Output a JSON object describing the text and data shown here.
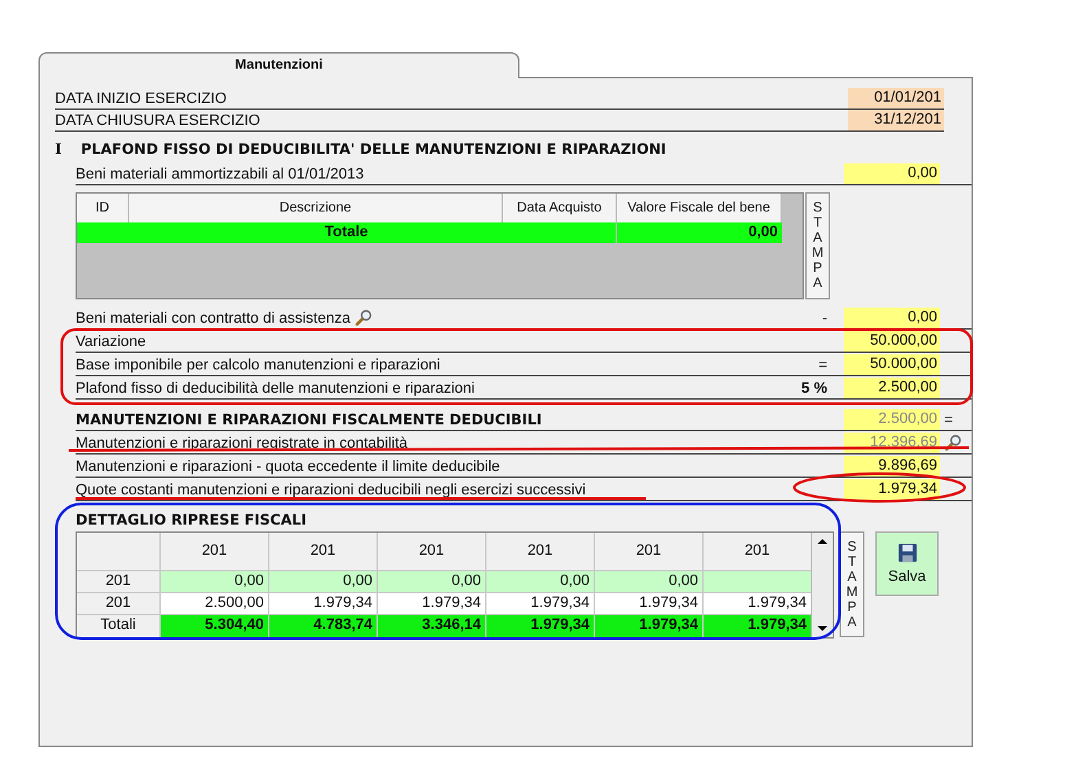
{
  "tabs": [
    {
      "label": "Manutenzioni",
      "selected": true
    }
  ],
  "dates": [
    {
      "label": "DATA INIZIO ESERCIZIO",
      "value": "01/01/201"
    },
    {
      "label": "DATA CHIUSURA ESERCIZIO",
      "value": "31/12/201"
    }
  ],
  "section": {
    "number": "I",
    "title": "PLAFOND FISSO DI DEDUCIBILITA' DELLE MANUTENZIONI E  RIPARAZIONI"
  },
  "assets_row": {
    "label": "Beni materiali ammortizzabili al 01/01/2013",
    "value": "0,00"
  },
  "assets_table": {
    "columns": [
      "ID",
      "Descrizione",
      "Data Acquisto",
      "Valore Fiscale del bene"
    ],
    "total_label": "Totale",
    "total_value": "0,00",
    "print_button": "STAMPA"
  },
  "rows": [
    {
      "kind": "row",
      "label": "Beni materiali con contratto di assistenza",
      "label_lookup": true,
      "sign": "-",
      "value": "0,00",
      "muted": false
    },
    {
      "kind": "row",
      "label": "Variazione",
      "value": "50.000,00",
      "muted": false
    },
    {
      "kind": "row",
      "label": "Base imponibile per calcolo manutenzioni e riparazioni",
      "sign": "=",
      "value": "50.000,00",
      "muted": false
    },
    {
      "kind": "row",
      "label": "Plafond fisso di deducibilità delle manutenzioni e riparazioni",
      "sign": "5 %",
      "value": "2.500,00",
      "muted": false
    },
    {
      "kind": "heading",
      "label": "MANUTENZIONI E RIPARAZIONI FISCALMENTE DEDUCIBILI",
      "value": "2.500,00",
      "suffix": "=",
      "muted": true
    },
    {
      "kind": "row",
      "label": "Manutenzioni e riparazioni registrate in contabilità",
      "value": "12.396,69",
      "value_lookup": true,
      "muted": true
    },
    {
      "kind": "row",
      "label": "Manutenzioni e riparazioni - quota eccedente il limite deducibile",
      "value": "9.896,69",
      "muted": false
    },
    {
      "kind": "row",
      "label": "Quote costanti manutenzioni e riparazioni deducibili negli esercizi successivi",
      "value": "1.979,34",
      "muted": false
    }
  ],
  "detail": {
    "title": "DETTAGLIO RIPRESE FISCALI",
    "columns": [
      "201",
      "201",
      "201",
      "201",
      "201",
      "201"
    ],
    "rows": [
      {
        "kind": "light",
        "label": "201",
        "values": [
          "0,00",
          "0,00",
          "0,00",
          "0,00",
          "0,00"
        ]
      },
      {
        "kind": "plain",
        "label": "201",
        "values": [
          "2.500,00",
          "1.979,34",
          "1.979,34",
          "1.979,34",
          "1.979,34",
          "1.979,34"
        ]
      },
      {
        "kind": "total",
        "label": "Totali",
        "values": [
          "5.304,40",
          "4.783,74",
          "3.346,14",
          "1.979,34",
          "1.979,34",
          "1.979,34"
        ]
      }
    ],
    "print_button": "STAMPA",
    "save_button": "Salva"
  }
}
